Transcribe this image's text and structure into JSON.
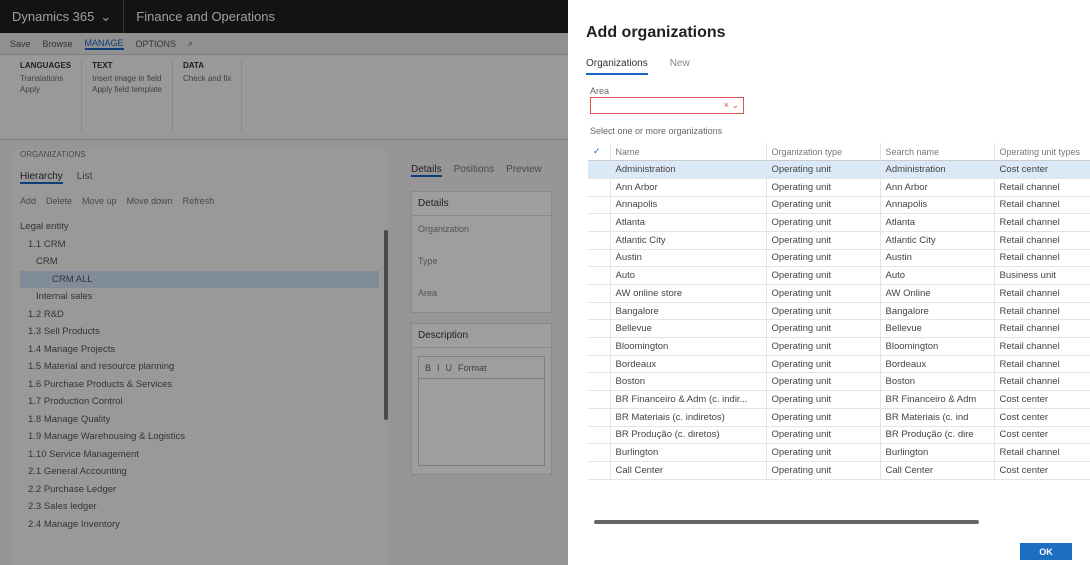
{
  "app": {
    "brand": "Dynamics 365",
    "module": "Finance and Operations",
    "actions": [
      "Save",
      "Browse",
      "MANAGE",
      "OPTIONS"
    ],
    "ribbon": [
      {
        "title": "LANGUAGES",
        "items": [
          "Translations",
          "Apply"
        ]
      },
      {
        "title": "TEXT",
        "items": [
          "Insert image in field",
          "Apply field template"
        ]
      },
      {
        "title": "DATA",
        "items": [
          "Check and fix"
        ]
      }
    ],
    "pane_title": "ORGANIZATIONS",
    "pane_tabs": [
      "Hierarchy",
      "List"
    ],
    "tools": [
      "Add",
      "Delete",
      "Move up",
      "Move down",
      "Refresh"
    ],
    "tree": [
      "Legal entity",
      "1.1 CRM",
      "CRM",
      "CRM ALL",
      "Internal sales",
      "1.2 R&D",
      "1.3 Sell Products",
      "1.4 Manage Projects",
      "1.5 Material and resource planning",
      "1.6 Purchase Products & Services",
      "1.7 Production Control",
      "1.8 Manage Quality",
      "1.9 Manage Warehousing & Logistics",
      "1.10 Service Management",
      "2.1 General Accounting",
      "2.2 Purchase Ledger",
      "2.3 Sales ledger",
      "2.4 Manage Inventory"
    ],
    "detail_tabs": [
      "Details",
      "Positions",
      "Preview"
    ],
    "detail_box": "Details",
    "fields": [
      "Organization",
      "Type",
      "Area"
    ],
    "description": "Description",
    "editor_tools": [
      "B",
      "I",
      "U",
      "Format"
    ]
  },
  "dialog": {
    "title": "Add organizations",
    "tabs": [
      "Organizations",
      "New"
    ],
    "area_label": "Area",
    "hint": "Select one or more organizations",
    "columns": [
      "Name",
      "Organization type",
      "Search name",
      "Operating unit types"
    ],
    "rows": [
      [
        "Administration",
        "Operating unit",
        "Administration",
        "Cost center"
      ],
      [
        "Ann Arbor",
        "Operating unit",
        "Ann Arbor",
        "Retail channel"
      ],
      [
        "Annapolis",
        "Operating unit",
        "Annapolis",
        "Retail channel"
      ],
      [
        "Atlanta",
        "Operating unit",
        "Atlanta",
        "Retail channel"
      ],
      [
        "Atlantic City",
        "Operating unit",
        "Atlantic City",
        "Retail channel"
      ],
      [
        "Austin",
        "Operating unit",
        "Austin",
        "Retail channel"
      ],
      [
        "Auto",
        "Operating unit",
        "Auto",
        "Business unit"
      ],
      [
        "AW online store",
        "Operating unit",
        "AW Online",
        "Retail channel"
      ],
      [
        "Bangalore",
        "Operating unit",
        "Bangalore",
        "Retail channel"
      ],
      [
        "Bellevue",
        "Operating unit",
        "Bellevue",
        "Retail channel"
      ],
      [
        "Bloomington",
        "Operating unit",
        "Bloomington",
        "Retail channel"
      ],
      [
        "Bordeaux",
        "Operating unit",
        "Bordeaux",
        "Retail channel"
      ],
      [
        "Boston",
        "Operating unit",
        "Boston",
        "Retail channel"
      ],
      [
        "BR Financeiro & Adm (c. indir...",
        "Operating unit",
        "BR Financeiro & Adm",
        "Cost center"
      ],
      [
        "BR Materiais (c. indiretos)",
        "Operating unit",
        "BR Materiais (c. ind",
        "Cost center"
      ],
      [
        "BR Produção (c. diretos)",
        "Operating unit",
        "BR Produção (c. dire",
        "Cost center"
      ],
      [
        "Burlington",
        "Operating unit",
        "Burlington",
        "Retail channel"
      ],
      [
        "Call Center",
        "Operating unit",
        "Call Center",
        "Cost center"
      ]
    ],
    "ok_label": "OK"
  }
}
